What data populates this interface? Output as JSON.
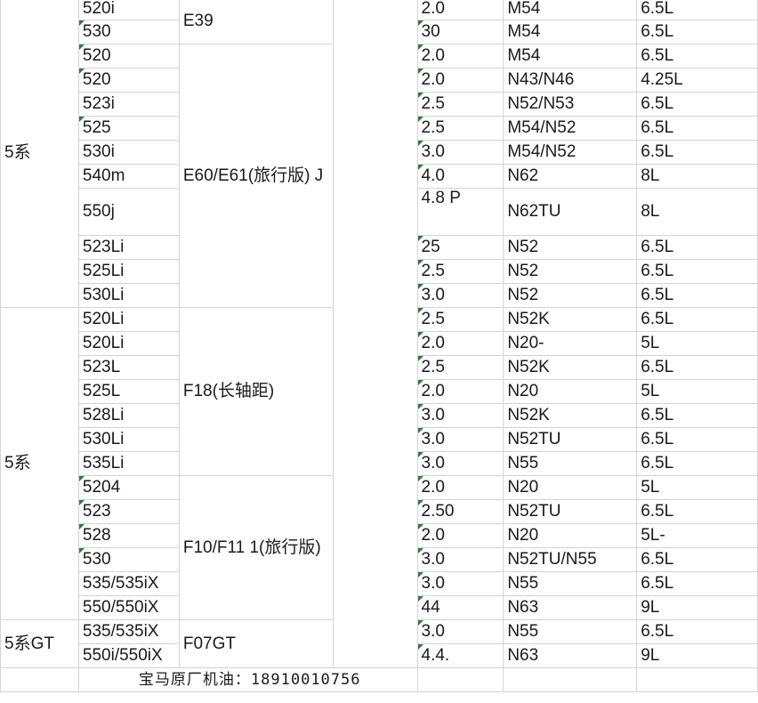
{
  "table": {
    "series": [
      "5系",
      "5系",
      "5系GT"
    ],
    "chassis": [
      "E39",
      "E60/E61(旅行版) J",
      "F18(长轴距)",
      "F10/F11 1(旅行版)",
      "F07GT"
    ],
    "rows": [
      {
        "model": "520i",
        "disp": "2.0",
        "engine": "M54",
        "oil": "6.5L"
      },
      {
        "model": "530",
        "disp": "30",
        "engine": "M54",
        "oil": "6.5L"
      },
      {
        "model": "520",
        "disp": "2.0",
        "engine": "M54",
        "oil": "6.5L"
      },
      {
        "model": "520",
        "disp": "2.0",
        "engine": "N43/N46",
        "oil": "4.25L"
      },
      {
        "model": "523i",
        "disp": "2.5",
        "engine": "N52/N53",
        "oil": "6.5L"
      },
      {
        "model": "525",
        "disp": "2.5",
        "engine": "M54/N52",
        "oil": "6.5L"
      },
      {
        "model": "530i",
        "disp": "3.0",
        "engine": "M54/N52",
        "oil": "6.5L"
      },
      {
        "model": "540m",
        "disp": "4.0",
        "engine": "N62",
        "oil": "8L"
      },
      {
        "model": "550j",
        "disp": "4.8 P",
        "engine": "N62TU",
        "oil": "8L"
      },
      {
        "model": "523Li",
        "disp": "25",
        "engine": "N52",
        "oil": "6.5L"
      },
      {
        "model": "525Li",
        "disp": "2.5",
        "engine": "N52",
        "oil": "6.5L"
      },
      {
        "model": "530Li",
        "disp": "3.0",
        "engine": "N52",
        "oil": "6.5L"
      },
      {
        "model": "520Li",
        "disp": "2.5",
        "engine": "N52K",
        "oil": "6.5L"
      },
      {
        "model": "520Li",
        "disp": "2.0",
        "engine": "N20-",
        "oil": "5L"
      },
      {
        "model": "523L",
        "disp": "2.5",
        "engine": "N52K",
        "oil": "6.5L"
      },
      {
        "model": "525L",
        "disp": "2.0",
        "engine": "N20",
        "oil": "5L"
      },
      {
        "model": "528Li",
        "disp": "3.0",
        "engine": "N52K",
        "oil": "6.5L"
      },
      {
        "model": "530Li",
        "disp": "3.0",
        "engine": "N52TU",
        "oil": "6.5L"
      },
      {
        "model": "535Li",
        "disp": "3.0",
        "engine": "N55",
        "oil": "6.5L"
      },
      {
        "model": "5204",
        "disp": "2.0",
        "engine": "N20",
        "oil": "5L"
      },
      {
        "model": "523",
        "disp": "2.50",
        "engine": "N52TU",
        "oil": "6.5L"
      },
      {
        "model": "528",
        "disp": "2.0",
        "engine": "N20",
        "oil": "5L-"
      },
      {
        "model": "530",
        "disp": "3.0",
        "engine": "N52TU/N55",
        "oil": "6.5L"
      },
      {
        "model": "535/535iX",
        "disp": "3.0",
        "engine": "N55",
        "oil": "6.5L"
      },
      {
        "model": "550/550iX",
        "disp": "44",
        "engine": "N63",
        "oil": "9L"
      },
      {
        "model": "535/535iX",
        "disp": "3.0",
        "engine": "N55",
        "oil": "6.5L"
      },
      {
        "model": "550i/550iX",
        "disp": "4.4.",
        "engine": "N63",
        "oil": "9L"
      }
    ],
    "footer": "宝马原厂机油：18910010756"
  }
}
